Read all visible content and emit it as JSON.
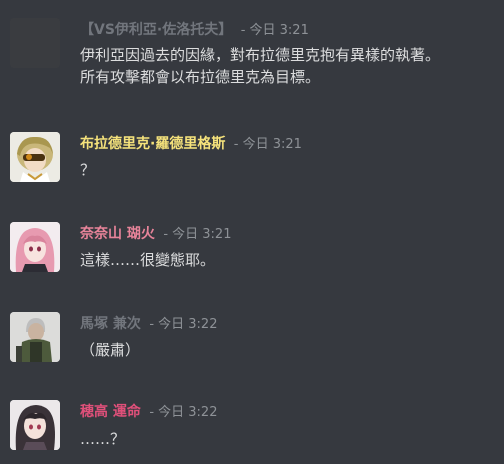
{
  "colors": {
    "background": "#36393f",
    "text": "#dcddde",
    "timestamp": "#8e9297"
  },
  "messages": [
    {
      "author": "【VS伊利亞·佐洛托夫】",
      "author_color": "#72767d",
      "timestamp": "- 今日 3:21",
      "lines": [
        "伊利亞因過去的因緣，對布拉德里克抱有異樣的執著。",
        "所有攻擊都會以布拉德里克為目標。"
      ],
      "avatar": "blank-avatar"
    },
    {
      "author": "布拉德里克·羅德里格斯",
      "author_color": "#f5e27b",
      "timestamp": "- 今日 3:21",
      "lines": [
        "？"
      ],
      "avatar": "blonde-masked-avatar"
    },
    {
      "author": "奈奈山 瑚火",
      "author_color": "#e8849a",
      "timestamp": "- 今日 3:21",
      "lines": [
        "這樣……很變態耶。"
      ],
      "avatar": "pink-hair-avatar"
    },
    {
      "author": "馬塚 兼次",
      "author_color": "#72767d",
      "timestamp": "- 今日 3:22",
      "lines": [
        "（嚴肅）"
      ],
      "avatar": "soldier-avatar"
    },
    {
      "author": "穂高 運命",
      "author_color": "#e0507a",
      "timestamp": "- 今日 3:22",
      "lines": [
        "……？"
      ],
      "avatar": "dark-hair-avatar"
    }
  ]
}
